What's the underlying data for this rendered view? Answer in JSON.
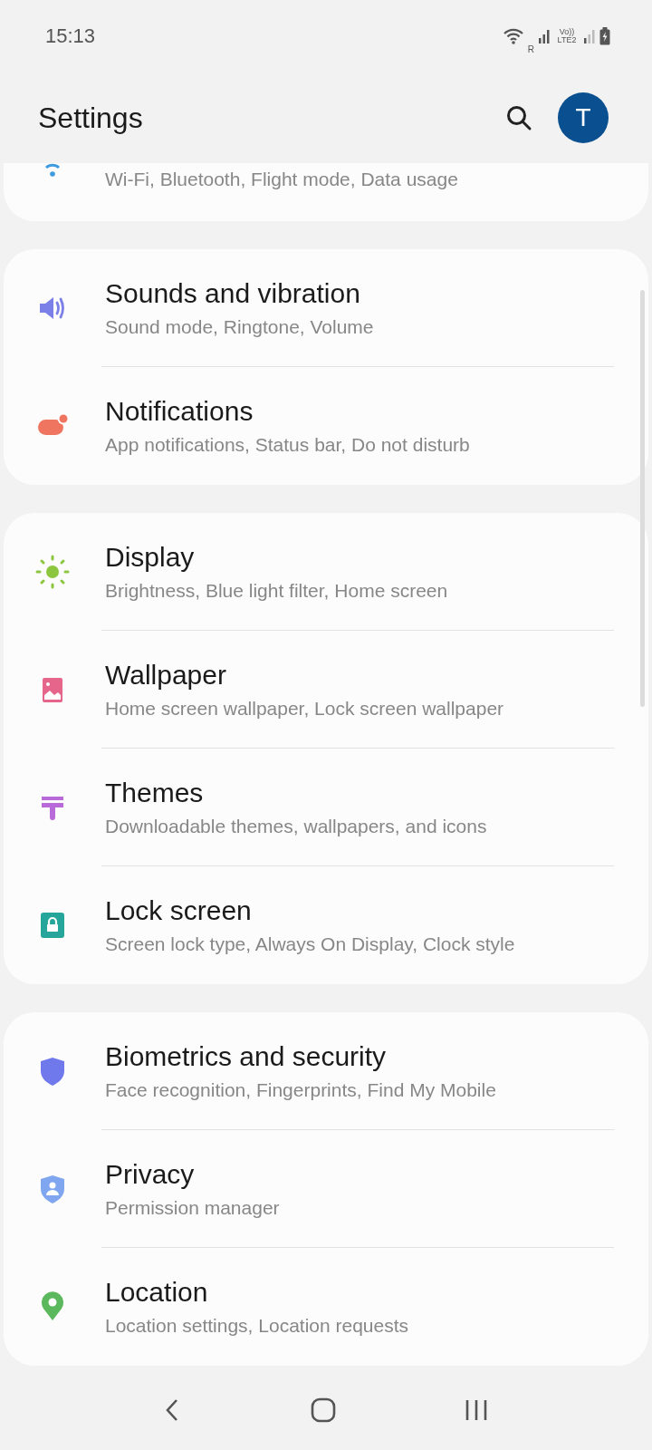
{
  "status_bar": {
    "time": "15:13",
    "signal_tag_1": "R",
    "signal_tag_2": "Vo)) LTE2"
  },
  "header": {
    "title": "Settings",
    "avatar_letter": "T"
  },
  "groups": [
    {
      "items": [
        {
          "subtitle": "Wi-Fi, Bluetooth, Flight mode, Data usage",
          "color": "#3f9be0"
        }
      ]
    },
    {
      "items": [
        {
          "title": "Sounds and vibration",
          "subtitle": "Sound mode, Ringtone, Volume",
          "color": "#7b7fe8"
        },
        {
          "title": "Notifications",
          "subtitle": "App notifications, Status bar, Do not disturb",
          "color": "#ef7560"
        }
      ]
    },
    {
      "items": [
        {
          "title": "Display",
          "subtitle": "Brightness, Blue light filter, Home screen",
          "color": "#8cc63f"
        },
        {
          "title": "Wallpaper",
          "subtitle": "Home screen wallpaper, Lock screen wallpaper",
          "color": "#e5668a"
        },
        {
          "title": "Themes",
          "subtitle": "Downloadable themes, wallpapers, and icons",
          "color": "#b86ad8"
        },
        {
          "title": "Lock screen",
          "subtitle": "Screen lock type, Always On Display, Clock style",
          "color": "#26a69a"
        }
      ]
    },
    {
      "items": [
        {
          "title": "Biometrics and security",
          "subtitle": "Face recognition, Fingerprints, Find My Mobile",
          "color": "#6f79ec"
        },
        {
          "title": "Privacy",
          "subtitle": "Permission manager",
          "color": "#7fa6ef"
        },
        {
          "title": "Location",
          "subtitle": "Location settings, Location requests",
          "color": "#5cb85c"
        }
      ]
    }
  ]
}
